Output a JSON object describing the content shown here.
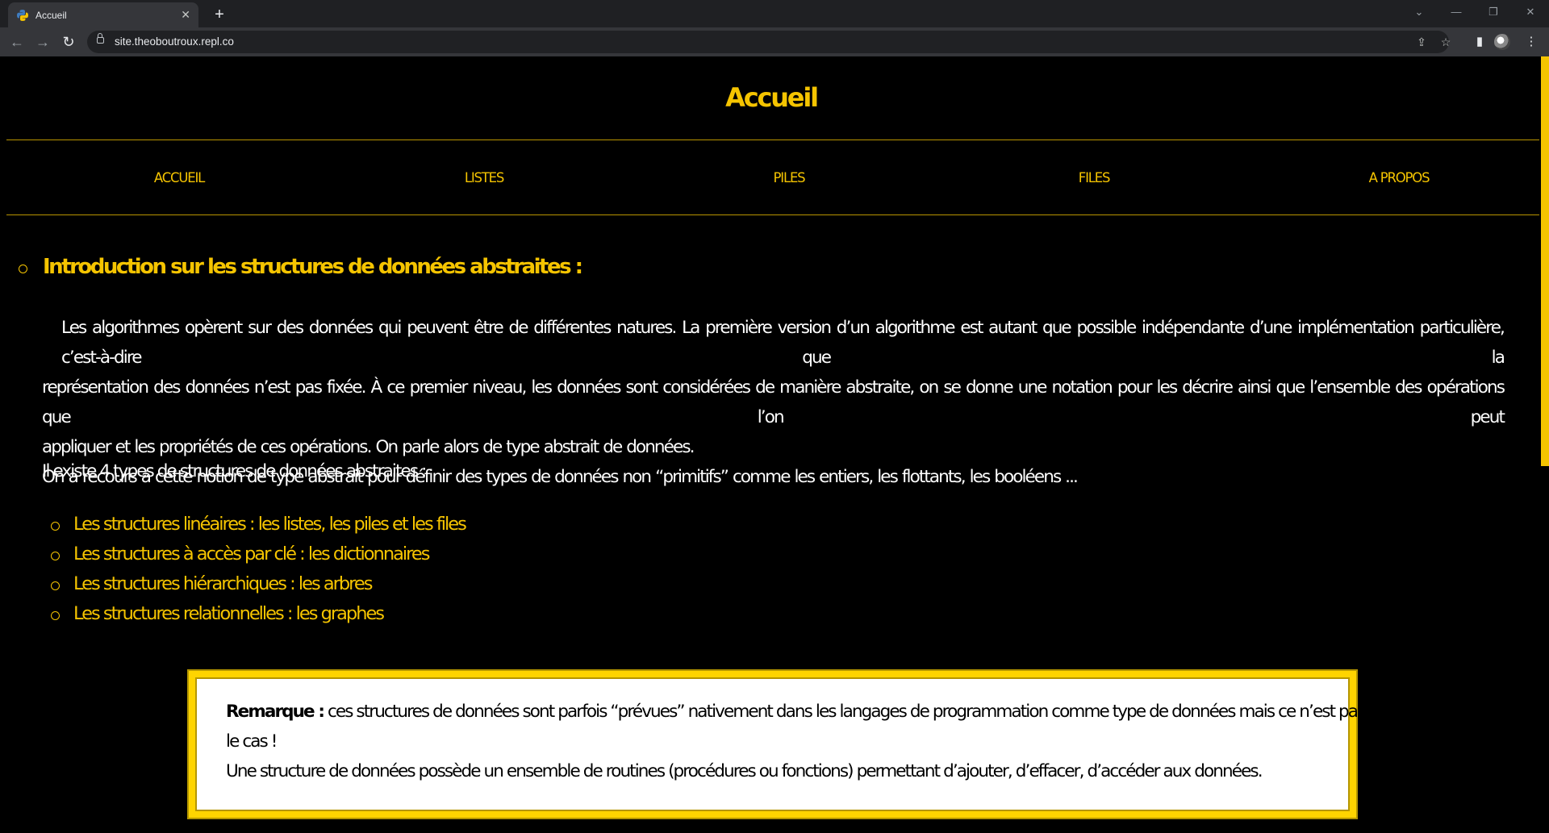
{
  "browser": {
    "tab": {
      "title": "Accueil",
      "favicon_icon": "python-logo-icon",
      "close_glyph": "✕"
    },
    "new_tab_glyph": "+",
    "window_controls": [
      "⌄",
      "—",
      "❐",
      "✕"
    ],
    "url": "site.theoboutroux.repl.co"
  },
  "colors": {
    "accent": "#f5c400",
    "background": "#000000",
    "text": "#ffffff",
    "remark_border": "#ffd400"
  },
  "page": {
    "title": "Accueil",
    "nav": [
      "ACCUEIL",
      "LISTES",
      "PILES",
      "FILES",
      "A PROPOS"
    ],
    "section_title": "Introduction sur les structures de données abstraites :",
    "paragraph_lines": [
      "Les algorithmes opèrent sur des données qui peuvent être de différentes natures. La première version d’un algorithme est autant que possible indépendante d’une implémentation particulière, c’est-à-dire que la",
      "représentation des données n’est pas fixée. À ce premier niveau, les données sont considérées de manière abstraite, on se donne une notation pour les décrire ainsi que l’ensemble des opérations que l’on peut",
      "appliquer et les propriétés de ces opérations. On parle alors de type abstrait de données.",
      "On a recours à cette notion de type abstrait pour définir des types de données non “primitifs” comme les entiers, les flottants, les booléens ..."
    ],
    "types_intro": "Il existe 4 types de structures de données abstraites :",
    "types": [
      "Les structures linéaires : les listes, les piles et les files",
      "Les structures à accès par clé : les dictionnaires",
      "Les structures hiérarchiques : les arbres",
      "Les structures relationnelles : les graphes"
    ],
    "remark": {
      "label": "Remarque :",
      "line1": "ces structures de données sont parfois “prévues” nativement dans les langages de programmation comme type de données mais ce n’est pas toujours",
      "line2": "le cas !",
      "line3": "Une structure de données possède un ensemble de routines (procédures ou fonctions) permettant d’ajouter, d’effacer, d’accéder aux données."
    }
  }
}
